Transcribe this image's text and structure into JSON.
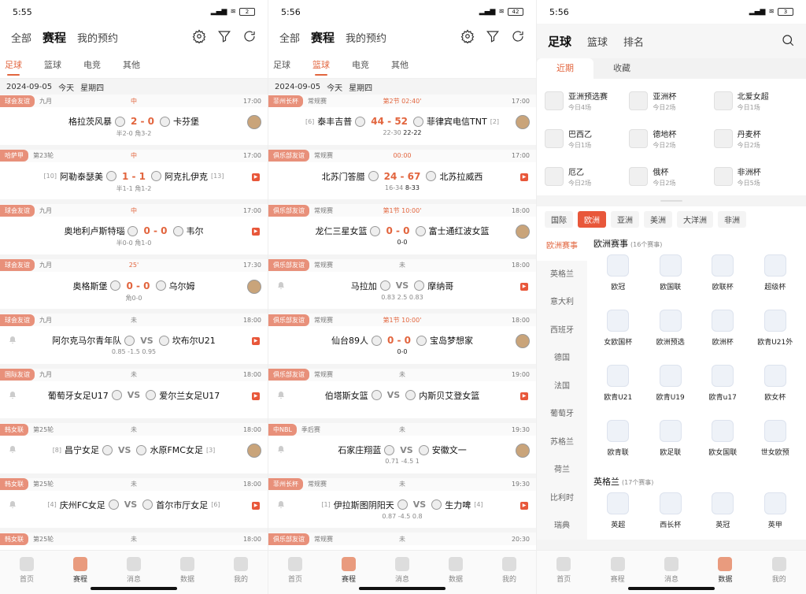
{
  "screens": [
    {
      "status_time": "5:55",
      "battery": "2",
      "nav": [
        "全部",
        "赛程",
        "我的预约"
      ],
      "sports": [
        "足球",
        "篮球",
        "电竞",
        "其他"
      ],
      "date": [
        "2024-09-05",
        "今天",
        "星期四"
      ],
      "matches": [
        {
          "tag": "球会友谊",
          "round": "九月",
          "status": "中",
          "time": "17:00",
          "home": "格拉茨风暴",
          "away": "卡芬堡",
          "score": "2 - 0",
          "sub": "半2-0  角3-2"
        },
        {
          "tag": "哈萨甲",
          "round": "第23轮",
          "status": "中",
          "time": "17:00",
          "home_rank": "[10]",
          "home": "阿勒泰瑟美",
          "away": "阿克扎伊克",
          "away_rank": "[13]",
          "score": "1 - 1",
          "sub": "半1-1  角1-2"
        },
        {
          "tag": "球会友谊",
          "round": "九月",
          "status": "中",
          "time": "17:00",
          "home": "奥地利卢斯特瑙",
          "away": "韦尔",
          "score": "0 - 0",
          "sub": "半0-0  角1-0"
        },
        {
          "tag": "球会友谊",
          "round": "九月",
          "status": "25'",
          "time": "17:30",
          "home": "奥格斯堡",
          "away": "乌尔姆",
          "score": "0 - 0",
          "sub": "角0-0"
        },
        {
          "tag": "球会友谊",
          "round": "九月",
          "status": "未",
          "time": "18:00",
          "home": "阿尔克马尔青年队",
          "away": "坎布尔U21",
          "score": "VS",
          "sub": "0.85  -1.5  0.95"
        },
        {
          "tag": "国际友谊",
          "round": "九月",
          "status": "未",
          "time": "18:00",
          "home": "葡萄牙女足U17",
          "away": "爱尔兰女足U17",
          "score": "VS",
          "sub": ""
        },
        {
          "tag": "韩女联",
          "round": "第25轮",
          "status": "未",
          "time": "18:00",
          "home_rank": "[8]",
          "home": "昌宁女足",
          "away": "水原FMC女足",
          "away_rank": "[3]",
          "score": "VS",
          "sub": ""
        },
        {
          "tag": "韩女联",
          "round": "第25轮",
          "status": "未",
          "time": "18:00",
          "home_rank": "[4]",
          "home": "庆州FC女足",
          "away": "首尔市厅女足",
          "away_rank": "[6]",
          "score": "VS",
          "sub": ""
        },
        {
          "tag": "韩女联",
          "round": "第25轮",
          "status": "未",
          "time": "18:00",
          "home": "",
          "away": "",
          "score": "",
          "sub": ""
        }
      ]
    },
    {
      "status_time": "5:56",
      "battery": "42",
      "nav": [
        "全部",
        "赛程",
        "我的预约"
      ],
      "sports": [
        "足球",
        "篮球",
        "电竞",
        "其他"
      ],
      "date": [
        "2024-09-05",
        "今天",
        "星期四"
      ],
      "matches": [
        {
          "tag": "菲州长杯",
          "round": "常规赛",
          "status": "第2节 02:40'",
          "time": "17:00",
          "home_rank": "[6]",
          "home": "泰丰吉普",
          "away": "菲律宾电信TNT",
          "away_rank": "[2]",
          "score": "44 - 52",
          "sub": "22-30",
          "sub2": "22-22"
        },
        {
          "tag": "俱乐部友谊",
          "round": "常规赛",
          "status": "00:00",
          "time": "17:00",
          "home": "北苏门答腊",
          "away": "北苏拉威西",
          "score": "24 - 67",
          "sub": "16-34",
          "sub2": "8-33"
        },
        {
          "tag": "俱乐部友谊",
          "round": "常规赛",
          "status": "第1节 10:00'",
          "time": "18:00",
          "home": "龙仁三星女篮",
          "away": "富士通红波女篮",
          "score": "0 - 0",
          "sub": "",
          "sub2": "0-0"
        },
        {
          "tag": "俱乐部友谊",
          "round": "常规赛",
          "status": "未",
          "time": "18:00",
          "home": "马拉加",
          "away": "摩纳哥",
          "score": "VS",
          "sub": "0.83  2.5  0.83"
        },
        {
          "tag": "俱乐部友谊",
          "round": "常规赛",
          "status": "第1节 10:00'",
          "time": "18:00",
          "home": "仙台89人",
          "away": "宝岛梦想家",
          "score": "0 - 0",
          "sub": "",
          "sub2": "0-0"
        },
        {
          "tag": "俱乐部友谊",
          "round": "常规赛",
          "status": "未",
          "time": "19:00",
          "home": "伯塔斯女篮",
          "away": "内斯贝艾登女篮",
          "score": "VS",
          "sub": ""
        },
        {
          "tag": "中NBL",
          "round": "季后赛",
          "status": "未",
          "time": "19:30",
          "home": "石家庄翔蓝",
          "away": "安徽文一",
          "score": "VS",
          "sub": "0.71  -4.5  1"
        },
        {
          "tag": "菲州长杯",
          "round": "常规赛",
          "status": "未",
          "time": "19:30",
          "home_rank": "[1]",
          "home": "伊拉斯图阴阳天",
          "away": "生力啤",
          "away_rank": "[4]",
          "score": "VS",
          "sub": "0.87  -4.5  0.8"
        },
        {
          "tag": "俱乐部友谊",
          "round": "常规赛",
          "status": "未",
          "time": "20:30",
          "home": "",
          "away": "",
          "score": "",
          "sub": ""
        }
      ]
    }
  ],
  "screen3": {
    "status_time": "5:56",
    "battery": "3",
    "nav": [
      "足球",
      "篮球",
      "排名"
    ],
    "recent_tabs": [
      "近期",
      "收藏"
    ],
    "recent": [
      {
        "name": "亚洲预选赛",
        "count": "今日4场"
      },
      {
        "name": "亚洲杯",
        "count": "今日2场"
      },
      {
        "name": "北爱女超",
        "count": "今日1场"
      },
      {
        "name": "巴西乙",
        "count": "今日1场"
      },
      {
        "name": "德地杯",
        "count": "今日2场"
      },
      {
        "name": "丹麦杯",
        "count": "今日2场"
      },
      {
        "name": "厄乙",
        "count": "今日2场"
      },
      {
        "name": "俄杯",
        "count": "今日2场"
      },
      {
        "name": "非洲杯",
        "count": "今日5场"
      }
    ],
    "regions": [
      "国际",
      "欧洲",
      "亚洲",
      "美洲",
      "大洋洲",
      "非洲"
    ],
    "left_menu": [
      "欧洲赛事",
      "英格兰",
      "意大利",
      "西班牙",
      "德国",
      "法国",
      "葡萄牙",
      "苏格兰",
      "荷兰",
      "比利时",
      "瑞典"
    ],
    "section1_title": "欧洲赛事",
    "section1_count": "(16个赛事)",
    "section1_items": [
      "欧冠",
      "欧国联",
      "欧联杯",
      "超级杯",
      "女欧国杯",
      "欧洲预选",
      "欧洲杯",
      "欧青U21外",
      "欧青U21",
      "欧青U19",
      "欧青u17",
      "欧女杯",
      "欧青联",
      "欧足联",
      "欧女国联",
      "世女欧预"
    ],
    "section2_title": "英格兰",
    "section2_count": "(17个赛事)",
    "section2_items": [
      "英超",
      "西长杯",
      "英冠",
      "英甲"
    ]
  },
  "tabbar": [
    "首页",
    "赛程",
    "消息",
    "数据",
    "我的"
  ],
  "colors": {
    "accent": "#e2653e",
    "tag": "#e8907a",
    "red_badge": "#e8573a"
  }
}
